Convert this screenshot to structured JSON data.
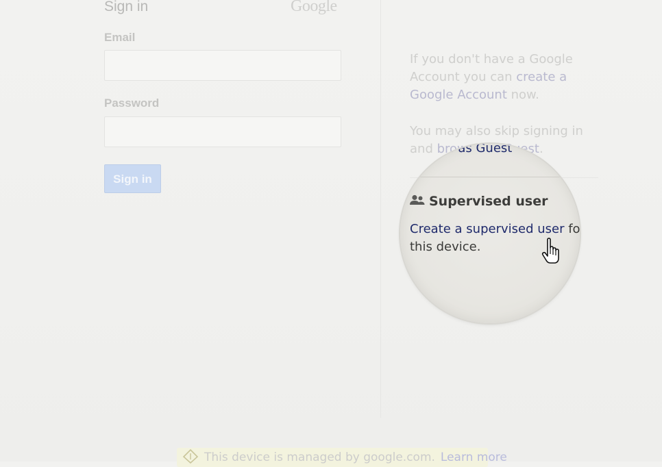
{
  "signin": {
    "title": "Sign in",
    "logo_text": "Google",
    "email_label": "Email",
    "email_placeholder": "",
    "password_label": "Password",
    "password_placeholder": "",
    "submit_label": "Sign in"
  },
  "info": {
    "account_text_before": "If you don't have a Google Account you can ",
    "create_account_link": "create a Google Account",
    "account_text_after": " now.",
    "guest_text_before": "You may also skip signing in and ",
    "guest_link": "browse as Guest",
    "guest_text_after": "."
  },
  "supervised": {
    "icon": "supervised-user-icon",
    "heading": "Supervised user",
    "link_text": "Create a supervised user",
    "text_after": " for this device."
  },
  "banner": {
    "icon": "managed-device-icon",
    "text": "This device is managed by google.com.",
    "link": "Learn more"
  },
  "colors": {
    "link_blue": "#1f2a6b",
    "button_bg": "#c9d9f2",
    "banner_bg": "#f3f3de"
  }
}
